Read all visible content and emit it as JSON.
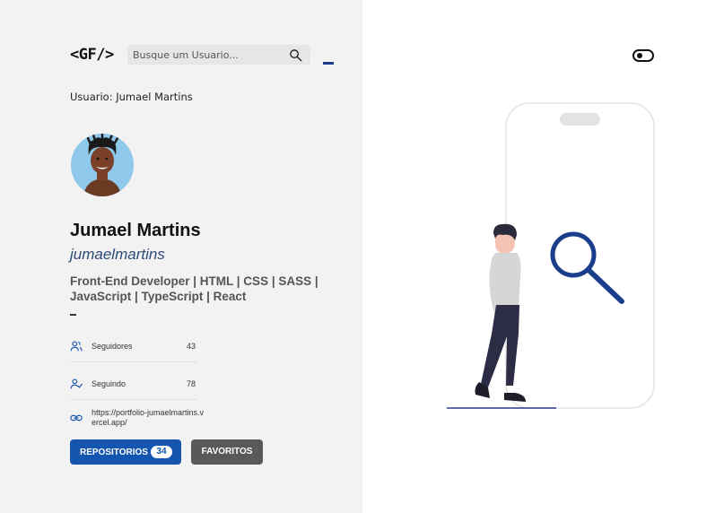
{
  "header": {
    "logo": "<GF/>",
    "search_placeholder": "Busque um Usuario..."
  },
  "user_caption": "Usuario: Jumael Martins",
  "profile": {
    "name": "Jumael Martins",
    "login": "jumaelmartins",
    "bio": "Front-End Developer | HTML | CSS | SASS | JavaScript | TypeScript | React",
    "followers": {
      "label": "Seguidores",
      "value": "43",
      "icon": "users-icon"
    },
    "following": {
      "label": "Seguindo",
      "value": "78",
      "icon": "user-check-icon"
    },
    "blog": {
      "url": "https://portfolio-jumaelmartins.vercel.app/",
      "icon": "link-icon"
    }
  },
  "buttons": {
    "repos_label": "REPOSITORIOS",
    "repos_count": "34",
    "favorites_label": "FAVORITOS"
  },
  "colors": {
    "accent": "#1455b0",
    "favorites_button": "#595959",
    "left_panel_bg": "#f2f2f2"
  }
}
